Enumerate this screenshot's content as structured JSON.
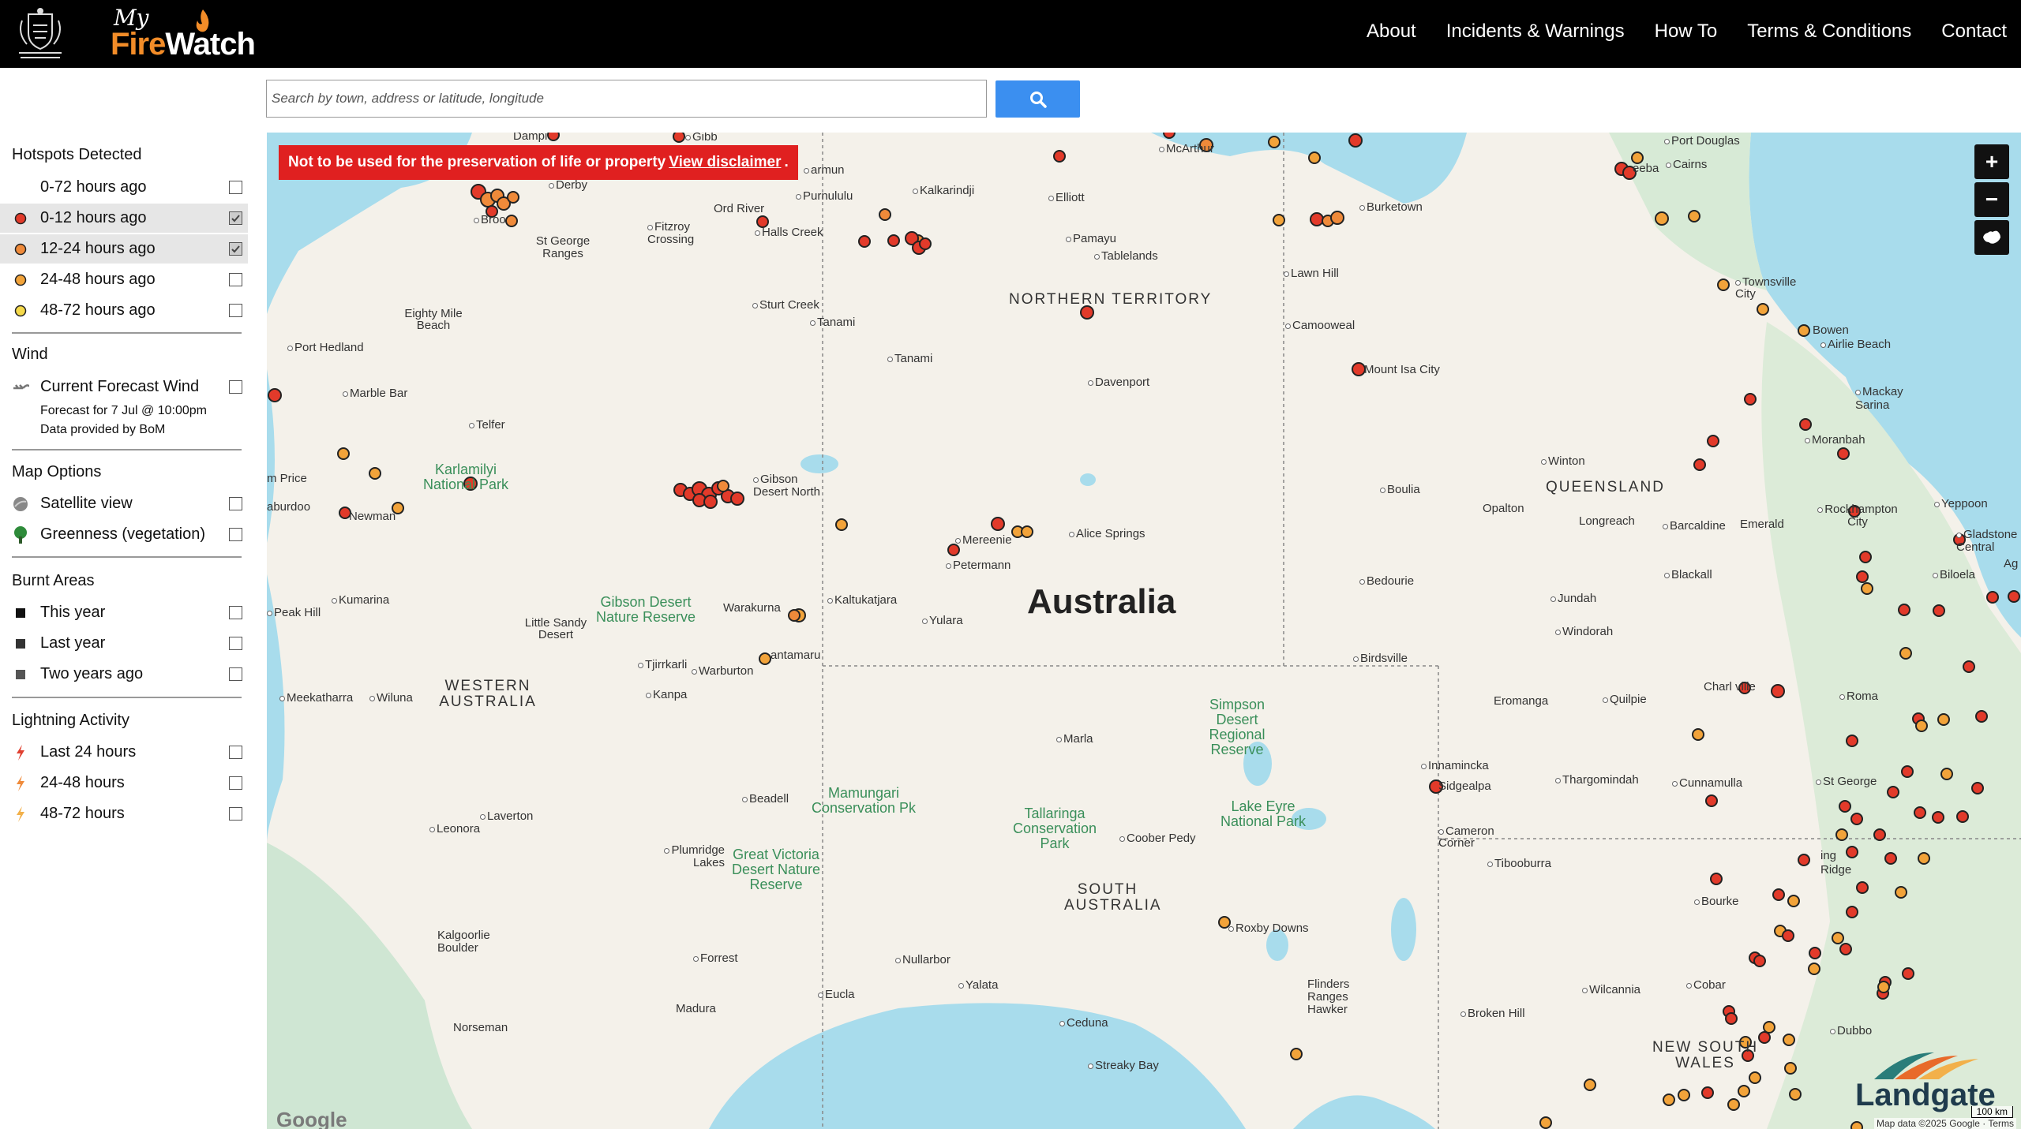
{
  "header": {
    "crest_text": "GOVERNMENT OF WESTERN AUSTRALIA",
    "logo_my": "My",
    "logo_fire": "Fire",
    "logo_watch": "Watch",
    "nav": [
      "About",
      "Incidents & Warnings",
      "How To",
      "Terms & Conditions",
      "Contact"
    ]
  },
  "search": {
    "placeholder": "Search by town, address or latitude, longitude"
  },
  "sidebar": {
    "hotspots": {
      "title": "Hotspots Detected",
      "items": [
        {
          "label": "0-72 hours ago",
          "checked": false,
          "color": ""
        },
        {
          "label": "0-12 hours ago",
          "checked": true,
          "color": "#e23a2a"
        },
        {
          "label": "12-24 hours ago",
          "checked": true,
          "color": "#ef8a3a"
        },
        {
          "label": "24-48 hours ago",
          "checked": false,
          "color": "#f2a33a"
        },
        {
          "label": "48-72 hours ago",
          "checked": false,
          "color": "#f5d94a"
        }
      ]
    },
    "wind": {
      "title": "Wind",
      "item": "Current Forecast Wind",
      "forecast": "Forecast for 7 Jul @ 10:00pm",
      "provider": "Data provided by BoM"
    },
    "map_options": {
      "title": "Map Options",
      "items": [
        "Satellite view",
        "Greenness (vegetation)"
      ]
    },
    "burnt": {
      "title": "Burnt Areas",
      "items": [
        "This year",
        "Last year",
        "Two years ago"
      ]
    },
    "lightning": {
      "title": "Lightning Activity",
      "items": [
        "Last 24 hours",
        "24-48 hours",
        "48-72 hours"
      ],
      "colors": [
        "#e04030",
        "#ef8a3a",
        "#f2b04a"
      ]
    }
  },
  "map": {
    "warning_text": "Not to be used for the preservation of life or property",
    "warning_link": "View disclaimer",
    "warning_end": ".",
    "zoom_in": "+",
    "zoom_out": "−",
    "country_label": "Australia",
    "regions": {
      "nt": "NORTHERN TERRITORY",
      "qld": "QUEENSLAND",
      "wa": "WESTERN AUSTRALIA",
      "sa": "SOUTH AUSTRALIA",
      "nsw": "NEW SOUTH WALES"
    },
    "parks": {
      "karlamilyi": "Karlamilyi National Park",
      "gibson": "Gibson Desert Nature Reserve",
      "simpson": "Simpson Desert Regional Reserve",
      "lake_eyre": "Lake Eyre National Park",
      "tallaringa": "Tallaringa Conservation Park",
      "mamungari": "Mamungari Conservation Pk",
      "great_victoria": "Great Victoria Desert Nature Reserve"
    },
    "places": {
      "dampier": "Dampi",
      "gibb": "Gibb",
      "derby": "Derby",
      "broome": "Broo",
      "fitzroy": "Fitzroy Crossing",
      "st_george": "St George Ranges",
      "halls_creek": "Halls Creek",
      "ord_river": "Ord River",
      "purnululu": "Purnululu",
      "kalkarindji": "Kalkarindji",
      "elliott": "Elliott",
      "pamayu": "Pamayu",
      "tablelands": "Tablelands",
      "burketown": "Burketown",
      "mcarthur": "McArthur",
      "port_douglas": "Port Douglas",
      "cairns": "Cairns",
      "mareeba": "eeba",
      "armun": "armun",
      "lawn_hill": "Lawn Hill",
      "camooweal": "Camooweal",
      "mount_isa": "Mount Isa City",
      "townsville": "Townsville City",
      "bowen": "Bowen",
      "airlie": "Airlie Beach",
      "mackay": "Mackay Sarina",
      "moranbah": "Moranbah",
      "winton": "Winton",
      "yeppoon": "Yeppoon",
      "rockhampton": "Rockhampton City",
      "gladstone": "Gladstone Central",
      "ag": "Ag",
      "biloela": "Biloela",
      "emerald": "Emerald",
      "longreach": "Longreach",
      "barcaldine": "Barcaldine",
      "opalton": "Opalton",
      "boulia": "Boulia",
      "blackall": "Blackall",
      "jundah": "Jundah",
      "windorah": "Windorah",
      "bedourie": "Bedourie",
      "birdsville": "Birdsville",
      "charleville": "Charl  ville",
      "roma": "Roma",
      "quilpie": "Quilpie",
      "eromanga": "Eromanga",
      "innamincka": "Innamincka",
      "sidgealpa": "Sidgealpa",
      "thargomindah": "Thargomindah",
      "cunnamulla": "Cunnamulla",
      "st_george_qld": "St George",
      "cameron": "Cameron Corner",
      "tibooburra": "Tibooburra",
      "ridge": "ing Ridge",
      "bourke": "Bourke",
      "cobar": "Cobar",
      "wilcannia": "Wilcannia",
      "broken_hill": "Broken Hill",
      "dubbo": "Dubbo",
      "sturt_creek": "Sturt Creek",
      "tanami1": "Tanami",
      "tanami2": "Tanami",
      "davenport": "Davenport",
      "eighty_mile": "Eighty Mile Beach",
      "port_hedland": "Port Hedland",
      "marble_bar": "Marble Bar",
      "telfer": "Telfer",
      "m_price": "m Price",
      "aburdoo": "aburdoo",
      "newman": "Newman",
      "gibson_north": "Gibson Desert North",
      "mereenie": "Mereenie",
      "petermann": "Petermann",
      "alice": "Alice Springs",
      "kaltukatjara": "Kaltukatjara",
      "yulara": "Yulara",
      "warakurna": "Warakurna",
      "kumarina": "Kumarina",
      "peak_hill": "Peak Hill",
      "little_sandy": "Little Sandy Desert",
      "tjirrkarli": "Tjirrkarli",
      "warburton": "Warburton",
      "kanpa": "Kanpa",
      "jantamaru": "antamaru",
      "meekatharra": "Meekatharra",
      "wiluna": "Wiluna",
      "marla": "Marla",
      "beadell": "Beadell",
      "coober_pedy": "Coober Pedy",
      "roxby": "Roxby Downs",
      "laverton": "Laverton",
      "leonora": "Leonora",
      "plumridge": "Plumridge Lakes",
      "kalgoorlie": "Kalgoorlie Boulder",
      "forrest": "Forrest",
      "nullarbor": "Nullarbor",
      "yalata": "Yalata",
      "eucla": "Eucla",
      "madura": "Madura",
      "norseman": "Norseman",
      "ceduna": "Ceduna",
      "streaky": "Streaky Bay",
      "flinders": "Flinders Ranges Hawker"
    },
    "google": "Google",
    "attribution": "Map data ©2025 Google · Terms",
    "scale": "100 km",
    "landgate": "Landgate"
  }
}
